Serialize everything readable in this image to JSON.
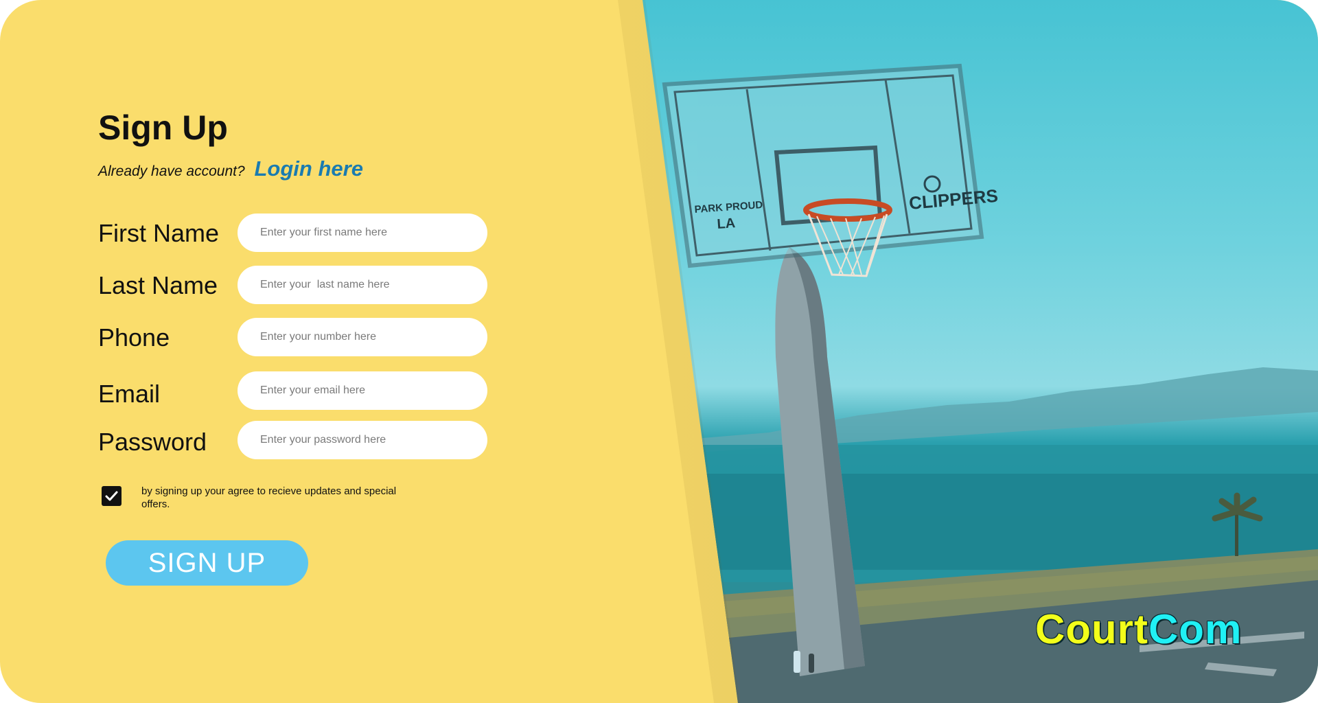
{
  "signup": {
    "title": "Sign Up",
    "already_text": "Already have account?",
    "login_link": "Login here"
  },
  "fields": [
    {
      "label": "First Name",
      "placeholder": "Enter your first name here"
    },
    {
      "label": "Last Name",
      "placeholder": "Enter your  last name here"
    },
    {
      "label": "Phone",
      "placeholder": "Enter your number here"
    },
    {
      "label": "Email",
      "placeholder": "Enter your email here"
    },
    {
      "label": "Password",
      "placeholder": "Enter your password here"
    }
  ],
  "terms": {
    "checked": true,
    "text": "by signing up your agree to recieve updates and special offers."
  },
  "button": {
    "label": "SIGN UP"
  },
  "brand": {
    "part1": "Court",
    "part2": "Com"
  },
  "backboard": {
    "left_text_1": "PARK PROUD",
    "left_text_2": "LA",
    "right_text": "CLIPPERS"
  },
  "colors": {
    "panel_bg": "#fadd6c",
    "button_bg": "#5cc6ef",
    "link": "#1a7bb0",
    "brand_part1": "#f3ff1a",
    "brand_part2": "#20f0f4"
  },
  "icons": {
    "checkbox": "checkmark-icon"
  }
}
